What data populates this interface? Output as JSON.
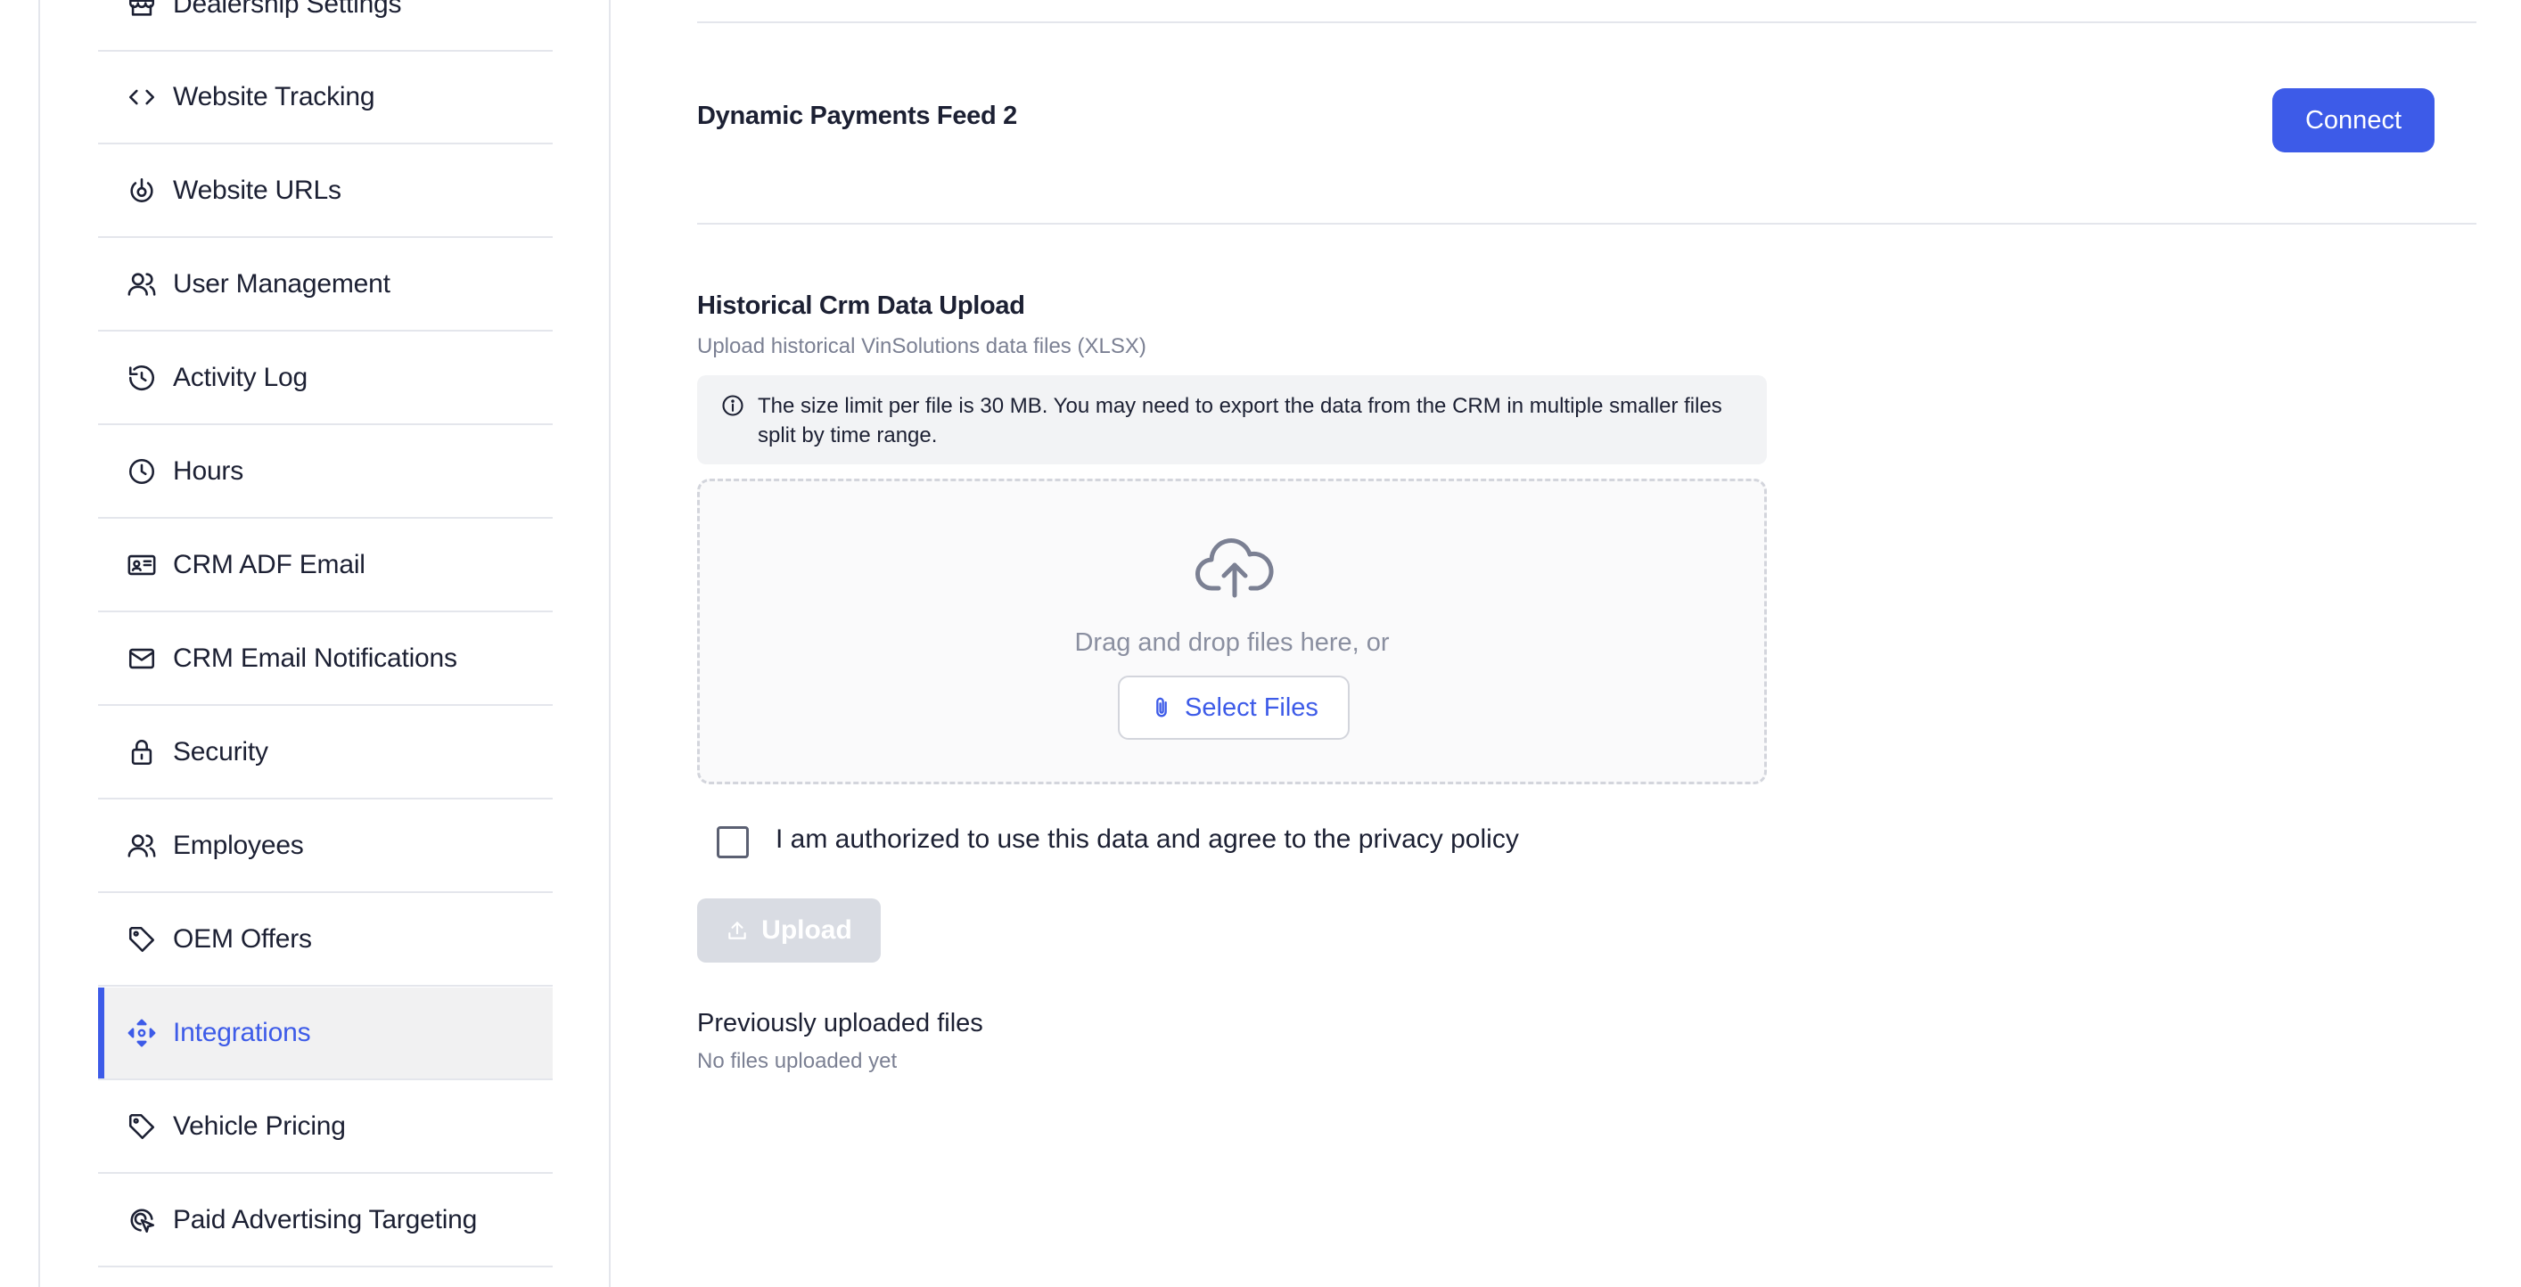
{
  "sidebar": {
    "items": [
      {
        "label": "Dealership Settings",
        "icon": "store-icon"
      },
      {
        "label": "Website Tracking",
        "icon": "code-icon"
      },
      {
        "label": "Website URLs",
        "icon": "power-pointer-icon"
      },
      {
        "label": "User Management",
        "icon": "users-icon"
      },
      {
        "label": "Activity Log",
        "icon": "history-icon"
      },
      {
        "label": "Hours",
        "icon": "clock-icon"
      },
      {
        "label": "CRM ADF Email",
        "icon": "id-card-icon"
      },
      {
        "label": "CRM Email Notifications",
        "icon": "mail-open-icon"
      },
      {
        "label": "Security",
        "icon": "lock-icon"
      },
      {
        "label": "Employees",
        "icon": "users-icon"
      },
      {
        "label": "OEM Offers",
        "icon": "tag-icon"
      },
      {
        "label": "Integrations",
        "icon": "move-arrows-icon",
        "active": true
      },
      {
        "label": "Vehicle Pricing",
        "icon": "tag-icon"
      },
      {
        "label": "Paid Advertising Targeting",
        "icon": "target-icon"
      }
    ]
  },
  "feed": {
    "title": "Dynamic Payments Feed 2",
    "connect_label": "Connect"
  },
  "upload": {
    "title": "Historical Crm Data Upload",
    "subtitle": "Upload historical VinSolutions data files (XLSX)",
    "info_text": "The size limit per file is 30 MB. You may need to export the data from the CRM in multiple smaller files split by time range.",
    "drop_text": "Drag and drop files here, or",
    "select_label": "Select Files",
    "agreement_label": "I am authorized to use this data and agree to the privacy policy",
    "agreement_checked": false,
    "upload_label": "Upload",
    "upload_disabled": true
  },
  "previous": {
    "title": "Previously uploaded files",
    "empty_text": "No files uploaded yet"
  },
  "colors": {
    "accent": "#3d5be8",
    "border": "#e4e6ec",
    "muted_text": "#7b8093",
    "active_bg": "#f1f1f2",
    "disabled_btn": "#d9dce3"
  }
}
